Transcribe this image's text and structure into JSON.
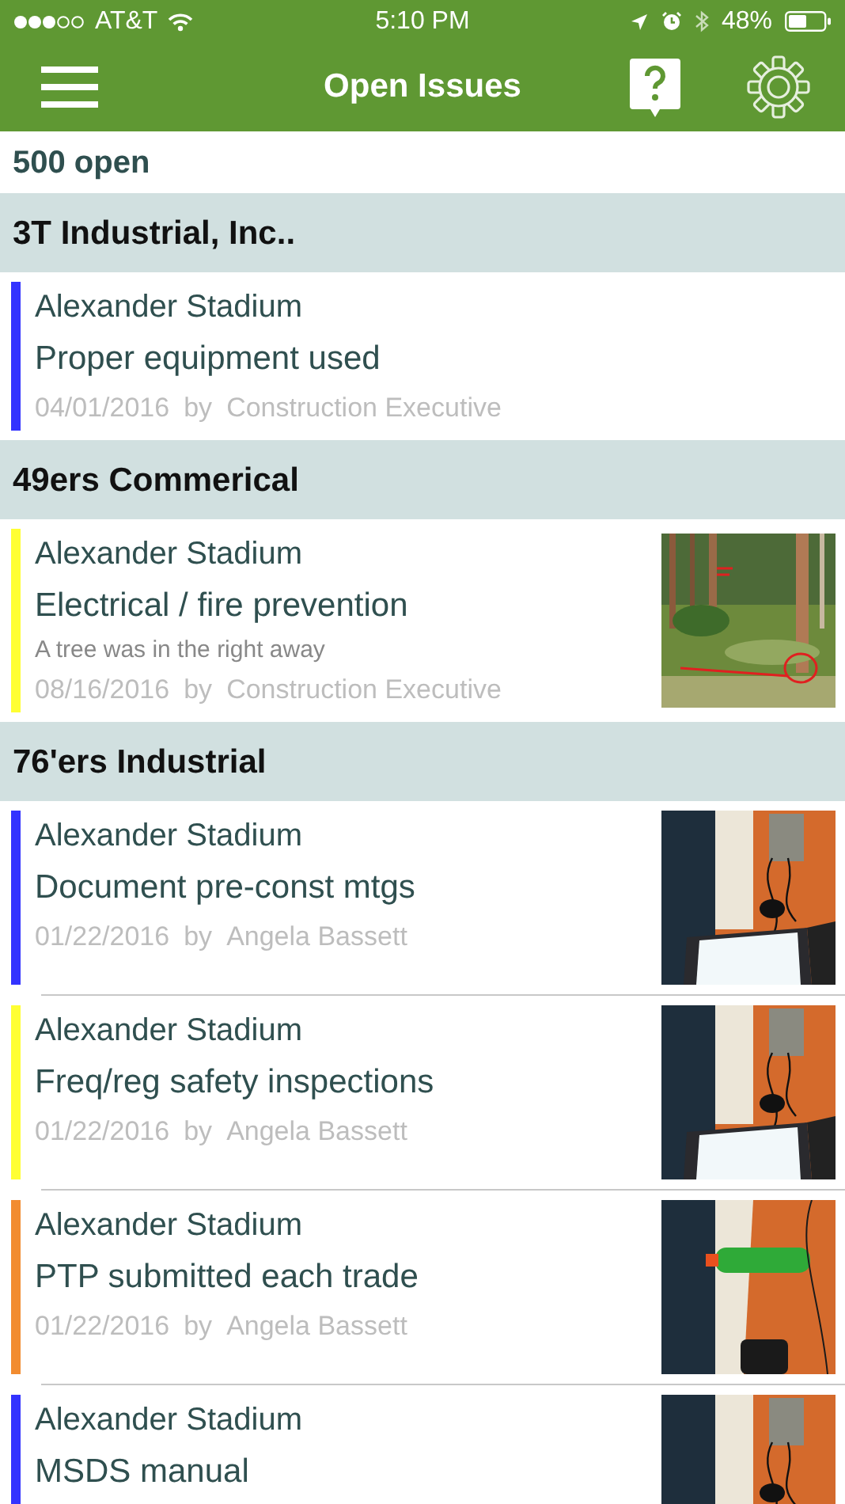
{
  "status_bar": {
    "carrier": "AT&T",
    "time": "5:10 PM",
    "battery": "48%"
  },
  "nav": {
    "title": "Open Issues"
  },
  "count": "500 open",
  "groups": [
    {
      "name": "3T Industrial, Inc..",
      "items": [
        {
          "site": "Alexander Stadium",
          "title": "Proper equipment used",
          "date": "04/01/2016",
          "by": "by",
          "author": "Construction Executive",
          "color": "#3333ff"
        }
      ]
    },
    {
      "name": "49ers Commerical",
      "items": [
        {
          "site": "Alexander Stadium",
          "title": "Electrical / fire prevention",
          "description": "A tree was in the right away",
          "date": "08/16/2016",
          "by": "by",
          "author": "Construction Executive",
          "color": "#ffff33"
        }
      ]
    },
    {
      "name": "76'ers Industrial",
      "items": [
        {
          "site": "Alexander Stadium",
          "title": "Document pre-const mtgs",
          "date": "01/22/2016",
          "by": "by",
          "author": "Angela Bassett",
          "color": "#3333ff"
        },
        {
          "site": "Alexander Stadium",
          "title": "Freq/reg safety inspections",
          "date": "01/22/2016",
          "by": "by",
          "author": "Angela Bassett",
          "color": "#ffff33"
        },
        {
          "site": "Alexander Stadium",
          "title": "PTP submitted each trade",
          "date": "01/22/2016",
          "by": "by",
          "author": "Angela Bassett",
          "color": "#f28c30"
        },
        {
          "site": "Alexander Stadium",
          "title": "MSDS manual",
          "color": "#3333ff"
        }
      ]
    }
  ]
}
